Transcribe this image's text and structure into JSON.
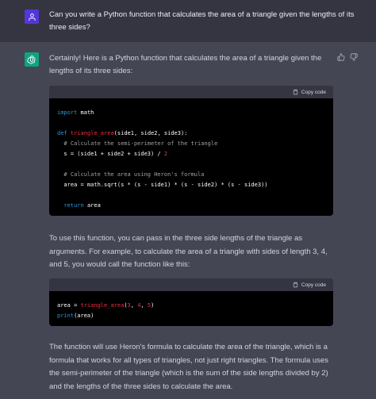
{
  "user_message": {
    "text": "Can you write a Python function that calculates the area of a triangle given the lengths of its three sides?",
    "avatar_icon": "user-icon",
    "avatar_color": "#5436da"
  },
  "assistant_message": {
    "avatar_icon": "openai-logo-icon",
    "avatar_color": "#10a37f",
    "intro": "Certainly! Here is a Python function that calculates the area of a triangle given the lengths of its three sides:",
    "feedback_icons": [
      "thumbs-up-icon",
      "thumbs-down-icon"
    ],
    "code_block_1": {
      "copy_label": "Copy code",
      "lines": {
        "l1_kw": "import",
        "l1_rest": " math",
        "l3_kw": "def",
        "l3_fn": "triangle_area",
        "l3_rest": "(side1, side2, side3):",
        "l4_cm": "  # Calculate the semi-perimeter of the triangle",
        "l5_a": "  s = (side1 + side2 + side3) / ",
        "l5_num": "2",
        "l7_cm": "  # Calculate the area using Heron's formula",
        "l8": "  area = math.sqrt(s * (s - side1) * (s - side2) * (s - side3))",
        "l10_kw": "return",
        "l10_rest": " area"
      }
    },
    "para_1": "To use this function, you can pass in the three side lengths of the triangle as arguments. For example, to calculate the area of a triangle with sides of length 3, 4, and 5, you would call the function like this:",
    "code_block_2": {
      "copy_label": "Copy code",
      "lines": {
        "l1_a": "area = ",
        "l1_fn": "triangle_area",
        "l1_b": "(",
        "l1_n1": "3",
        "l1_c": ", ",
        "l1_n2": "4",
        "l1_d": ", ",
        "l1_n3": "5",
        "l1_e": ")",
        "l2_fn": "print",
        "l2_rest": "(area)"
      }
    },
    "para_2": "The function will use Heron's formula to calculate the area of the triangle, which is a formula that works for all types of triangles, not just right triangles. The formula uses the semi-perimeter of the triangle (which is the sum of the side lengths divided by 2) and the lengths of the three sides to calculate the area."
  }
}
